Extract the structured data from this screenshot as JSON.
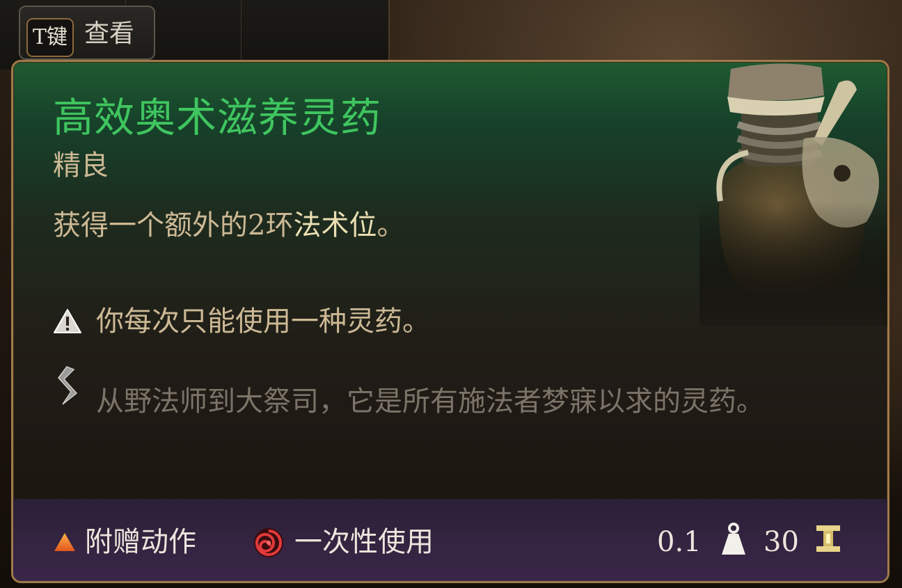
{
  "key_hint": {
    "key": "T键",
    "label": "查看"
  },
  "item": {
    "name": "高效奥术滋养灵药",
    "rarity": "精良",
    "description_prefix": "获得一个额外的2环",
    "description_highlight": "法术位",
    "description_suffix": "。",
    "warning": "你每次只能使用一种灵药。",
    "lore": "从野法师到大祭司，它是所有施法者梦寐以求的灵药。"
  },
  "footer": {
    "action_type": "附赠动作",
    "usage": "一次性使用",
    "weight": "0.1",
    "price": "30"
  },
  "colors": {
    "title": "#3fc55f",
    "rarity_text": "#cdb995",
    "lore_text": "#7c7468",
    "border": "#a07a4a"
  },
  "icons": [
    "warning-icon",
    "lore-quill-icon",
    "bonus-action-triangle-icon",
    "single-use-swirl-icon",
    "weight-icon",
    "gold-price-icon",
    "potion-item-art"
  ]
}
